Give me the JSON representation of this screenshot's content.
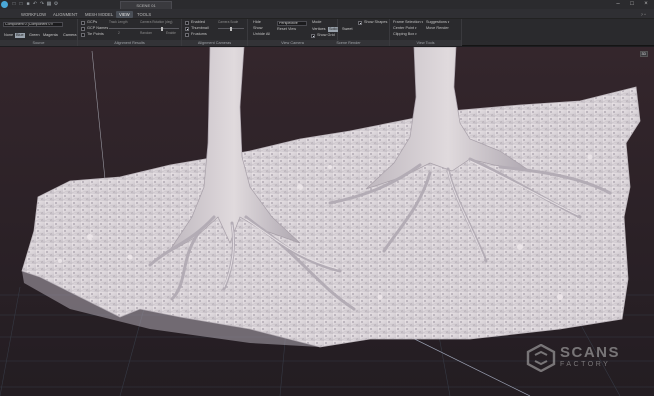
{
  "titlebar": {
    "document_tab": "SCENE 01",
    "quick_access": [
      "new-icon",
      "open-icon",
      "save-icon",
      "undo-icon",
      "redo-icon",
      "grid-icon",
      "settings-icon"
    ],
    "window_controls": [
      "minimize-icon",
      "maximize-icon",
      "close-icon"
    ]
  },
  "menu": {
    "items": [
      "WORKFLOW",
      "ALIGNMENT",
      "MESH MODEL",
      "VIEW",
      "TOOLS"
    ],
    "active": "VIEW",
    "right_label": "?  ^"
  },
  "ribbon": {
    "source": {
      "title": "Source",
      "component_value": "Component 0 (Component 0",
      "modes": [
        "None",
        "Blue",
        "Green",
        "Magenta",
        "Camera"
      ],
      "selected_mode": "Blue"
    },
    "alignment_results": {
      "title": "Alignment Results",
      "checks": [
        {
          "label": "GCPs",
          "checked": false
        },
        {
          "label": "GCP Names",
          "checked": false
        },
        {
          "label": "Tie Points",
          "checked": false
        }
      ],
      "track_length_label": "Track Length",
      "camera_rotation_label": "Camera Rotation (deg)",
      "track_length_value": "2",
      "rotation_min_label": "Random",
      "rotation_max_label": "Enable"
    },
    "alignment_cameras": {
      "title": "Alignment Cameras",
      "checks": [
        {
          "label": "Enabled",
          "checked": false
        },
        {
          "label": "Thumbnail",
          "checked": true
        },
        {
          "label": "Frustums",
          "checked": false
        }
      ],
      "camera_scale_label": "Camera Scale"
    },
    "view_camera": {
      "title": "View Camera",
      "items": [
        "Hide",
        "Show",
        "Unhide All"
      ],
      "projection_value": "Perspective",
      "reset_label": "Reset View"
    },
    "scene_render": {
      "title": "Scene Render",
      "mode_label": "Mode",
      "modes": [
        "Vertices",
        "Solid",
        "Sweet"
      ],
      "selected_mode": "Solid",
      "show_grid_label": "Show Grid",
      "show_grid_checked": true,
      "show_shapes_label": "Show Shapes",
      "show_shapes_checked": true
    },
    "view_tools": {
      "title": "View Tools",
      "items": [
        "Frame Selection",
        "Suggestions",
        "Center Point",
        "Move Render",
        "Clipping Box"
      ]
    }
  },
  "viewport": {
    "corner_tag": "3D",
    "watermark_line1": "SCANS",
    "watermark_line2": "FACTORY"
  },
  "colors": {
    "background": "#2e2429",
    "ground": "#ddd8dc",
    "ribbon": "#2a2a2d",
    "accent": "#4aa8d8"
  }
}
